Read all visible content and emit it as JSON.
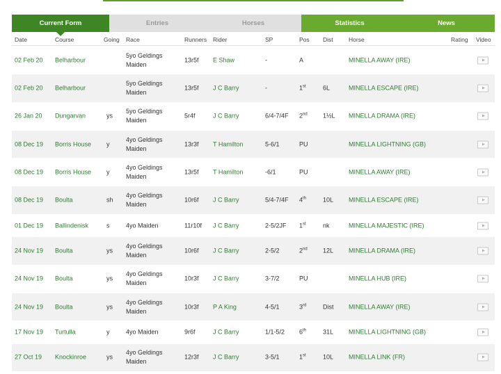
{
  "tabs": [
    {
      "label": "Current Form"
    },
    {
      "label": "Entries"
    },
    {
      "label": "Horses"
    },
    {
      "label": "Statistics"
    },
    {
      "label": "News"
    }
  ],
  "columns": {
    "date": "Date",
    "course": "Course",
    "going": "Going",
    "race": "Race",
    "runners": "Runners",
    "rider": "Rider",
    "sp": "SP",
    "pos": "Pos",
    "dist": "Dist",
    "horse": "Horse",
    "rating": "Rating",
    "video": "Video"
  },
  "colors": {
    "tab_active": "#3e8524",
    "tab_inactive": "#e0e0e0",
    "tab_secondary": "#6aaa2e",
    "link_green": "#2e7d32",
    "row_alt": "#f1f1f1"
  },
  "rows": [
    {
      "date": "02 Feb 20",
      "course": "Belharbour",
      "going": "",
      "race": "5yo Geldings Maiden",
      "runners": "13r5f",
      "rider": "E Shaw",
      "sp": "-",
      "pos": "A",
      "pos_sup": "",
      "dist": "",
      "horse": "MINELLA AWAY (IRE)",
      "rating": "",
      "video": "play-icon"
    },
    {
      "date": "02 Feb 20",
      "course": "Belharbour",
      "going": "",
      "race": "5yo Geldings Maiden",
      "runners": "13r5f",
      "rider": "J C Barry",
      "sp": "-",
      "pos": "1",
      "pos_sup": "st",
      "dist": "6L",
      "horse": "MINELLA ESCAPE (IRE)",
      "rating": "",
      "video": "play-icon"
    },
    {
      "date": "26 Jan 20",
      "course": "Dungarvan",
      "going": "ys",
      "race": "5yo Geldings Maiden",
      "runners": "5r4f",
      "rider": "J C Barry",
      "sp": "6/4-7/4F",
      "pos": "2",
      "pos_sup": "nd",
      "dist": "1½L",
      "horse": "MINELLA DRAMA (IRE)",
      "rating": "",
      "video": "play-icon"
    },
    {
      "date": "08 Dec 19",
      "course": "Borris House",
      "going": "y",
      "race": "4yo Geldings Maiden",
      "runners": "13r3f",
      "rider": "T Hamilton",
      "sp": "5-6/1",
      "pos": "PU",
      "pos_sup": "",
      "dist": "",
      "horse": "MINELLA LIGHTNING (GB)",
      "rating": "",
      "video": "play-icon"
    },
    {
      "date": "08 Dec 19",
      "course": "Borris House",
      "going": "y",
      "race": "4yo Geldings Maiden",
      "runners": "13r5f",
      "rider": "T Hamilton",
      "sp": "-6/1",
      "pos": "PU",
      "pos_sup": "",
      "dist": "",
      "horse": "MINELLA AWAY (IRE)",
      "rating": "",
      "video": "play-icon"
    },
    {
      "date": "08 Dec 19",
      "course": "Boulta",
      "going": "sh",
      "race": "4yo Geldings Maiden",
      "runners": "10r6f",
      "rider": "J C Barry",
      "sp": "5/4-7/4F",
      "pos": "4",
      "pos_sup": "th",
      "dist": "10L",
      "horse": "MINELLA ESCAPE (IRE)",
      "rating": "",
      "video": "play-icon"
    },
    {
      "date": "01 Dec 19",
      "course": "Ballindenisk",
      "going": "s",
      "race": "4yo Maiden",
      "runners": "11r10f",
      "rider": "J C Barry",
      "sp": "2-5/2JF",
      "pos": "1",
      "pos_sup": "st",
      "dist": "nk",
      "horse": "MINELLA MAJESTIC (IRE)",
      "rating": "",
      "video": "play-icon"
    },
    {
      "date": "24 Nov 19",
      "course": "Boulta",
      "going": "ys",
      "race": "4yo Geldings Maiden",
      "runners": "10r6f",
      "rider": "J C Barry",
      "sp": "2-5/2",
      "pos": "2",
      "pos_sup": "nd",
      "dist": "12L",
      "horse": "MINELLA DRAMA (IRE)",
      "rating": "",
      "video": "play-icon"
    },
    {
      "date": "24 Nov 19",
      "course": "Boulta",
      "going": "ys",
      "race": "4yo Geldings Maiden",
      "runners": "10r3f",
      "rider": "J C Barry",
      "sp": "3-7/2",
      "pos": "PU",
      "pos_sup": "",
      "dist": "",
      "horse": "MINELLA HUB (IRE)",
      "rating": "",
      "video": "play-icon"
    },
    {
      "date": "24 Nov 19",
      "course": "Boulta",
      "going": "ys",
      "race": "4yo Geldings Maiden",
      "runners": "10r3f",
      "rider": "P A King",
      "sp": "4-5/1",
      "pos": "3",
      "pos_sup": "rd",
      "dist": "Dist",
      "horse": "MINELLA AWAY (IRE)",
      "rating": "",
      "video": "play-icon"
    },
    {
      "date": "17 Nov 19",
      "course": "Turtulla",
      "going": "y",
      "race": "4yo Maiden",
      "runners": "9r6f",
      "rider": "J C Barry",
      "sp": "1/1-5/2",
      "pos": "6",
      "pos_sup": "th",
      "dist": "31L",
      "horse": "MINELLA LIGHTNING (GB)",
      "rating": "",
      "video": "play-icon"
    },
    {
      "date": "27 Oct 19",
      "course": "Knockinroe",
      "going": "ys",
      "race": "4yo Geldings Maiden",
      "runners": "12r3f",
      "rider": "J C Barry",
      "sp": "3-5/1",
      "pos": "1",
      "pos_sup": "st",
      "dist": "10L",
      "horse": "MINELLA LINK (FR)",
      "rating": "",
      "video": "play-icon"
    }
  ]
}
